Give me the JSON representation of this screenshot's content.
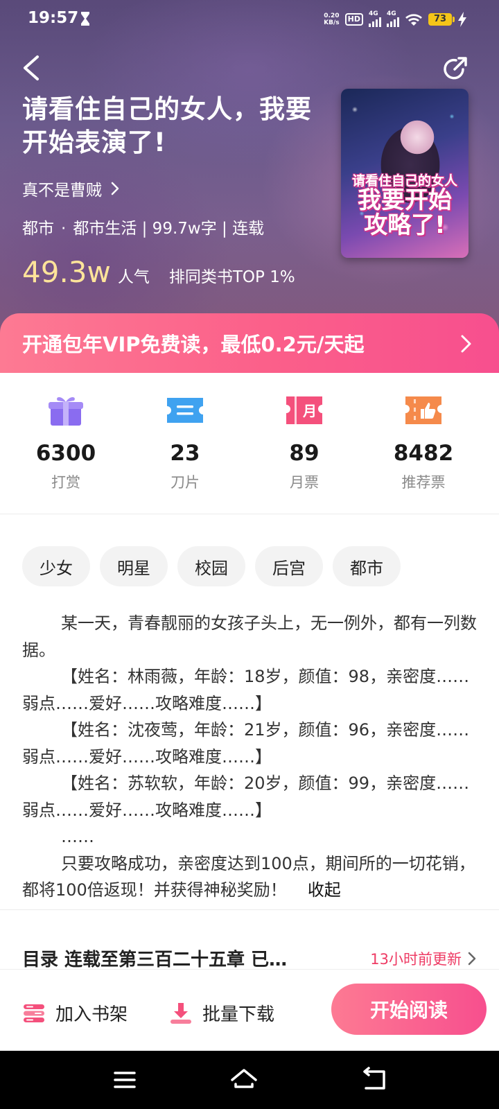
{
  "status_bar": {
    "time": "19:57",
    "net_speed_value": "0.20",
    "net_speed_unit": "KB/s",
    "hd": "HD",
    "sim1": "4G",
    "sim2": "4G",
    "battery": "73"
  },
  "book": {
    "title": "请看住自己的女人，我要开始表演了!",
    "author": "真不是曹贼",
    "category": "都市",
    "meta_separator": "·",
    "meta_rest": "都市生活 | 99.7w字 | 连载",
    "popularity_value": "49.3w",
    "popularity_unit": "人气",
    "rank": "排同类书TOP 1%",
    "cover_text": {
      "line1": "请看住自己的女人",
      "line2": "我要开始",
      "line3": "攻略了!"
    }
  },
  "vip_banner": {
    "text": "开通包年VIP免费读，最低0.2元/天起"
  },
  "stats": [
    {
      "value": "6300",
      "label": "打赏",
      "icon": "gift-icon",
      "color": "#8a6cf0"
    },
    {
      "value": "23",
      "label": "刀片",
      "icon": "ticket-icon",
      "color": "#3fa2f0"
    },
    {
      "value": "89",
      "label": "月票",
      "icon": "monthly-ticket-icon",
      "color": "#f4507c",
      "icon_text": "月"
    },
    {
      "value": "8482",
      "label": "推荐票",
      "icon": "thumbs-up-ticket-icon",
      "color": "#f58a4b"
    }
  ],
  "tags": [
    "少女",
    "明星",
    "校园",
    "后宫",
    "都市"
  ],
  "synopsis": {
    "paragraphs": [
      "某一天，青春靓丽的女孩子头上，无一例外，都有一列数据。",
      "【姓名：林雨薇，年龄：18岁，颜值：98，亲密度……弱点……爱好……攻略难度……】",
      "【姓名：沈夜莺，年龄：21岁，颜值：96，亲密度……弱点……爱好……攻略难度……】",
      "【姓名：苏软软，年龄：20岁，颜值：99，亲密度……弱点……爱好……攻略难度……】",
      "……",
      "只要攻略成功，亲密度达到100点，期间所的一切花销，都将100倍返现！并获得神秘奖励！"
    ],
    "collapse": "收起"
  },
  "catalog": {
    "title": "目录 连载至第三百二十五章 已…",
    "update": "13小时前更新"
  },
  "bottom_bar": {
    "add_shelf": "加入书架",
    "batch_download": "批量下载",
    "start_reading": "开始阅读"
  },
  "colors": {
    "accent_pink": "#f85a8a",
    "popularity_gold": "#ffe49a"
  }
}
